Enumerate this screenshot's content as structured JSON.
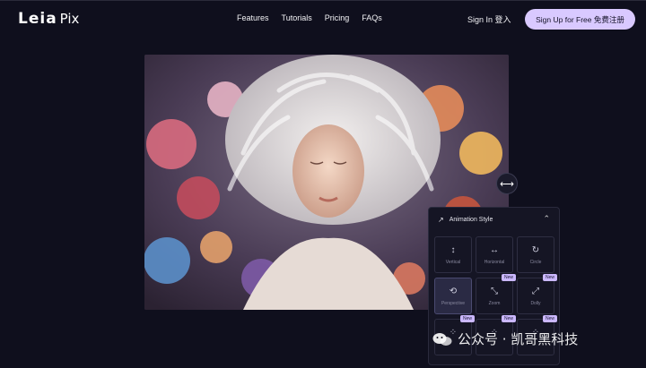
{
  "brand": {
    "logo_main": "Leia",
    "logo_sub": "Pix"
  },
  "nav": {
    "items": [
      "Features",
      "Tutorials",
      "Pricing",
      "FAQs"
    ]
  },
  "auth": {
    "signin_label": "Sign In 登入",
    "signup_label": "Sign Up for Free 免费注册"
  },
  "viewer": {
    "image_subject": "portrait of woman with white sculpted hair and colorful flowers",
    "compare_icon": "horizontal-arrows-icon"
  },
  "animation_panel": {
    "title": "Animation Style",
    "collapse_icon": "chevron-up-icon",
    "styles": [
      {
        "label": "Vertical",
        "icon": "vertical-arrows-icon",
        "new": "",
        "selected": false
      },
      {
        "label": "Horizontal",
        "icon": "horizontal-arrows-icon",
        "new": "",
        "selected": false
      },
      {
        "label": "Circle",
        "icon": "circle-arrow-icon",
        "new": "",
        "selected": false
      },
      {
        "label": "Perspective",
        "icon": "perspective-icon",
        "new": "",
        "selected": true
      },
      {
        "label": "Zoom",
        "icon": "zoom-icon",
        "new": "New",
        "selected": false
      },
      {
        "label": "Dolly",
        "icon": "dolly-icon",
        "new": "New",
        "selected": false
      },
      {
        "label": "",
        "icon": "effect-icon",
        "new": "New",
        "selected": false
      },
      {
        "label": "",
        "icon": "effect-icon",
        "new": "New",
        "selected": false
      },
      {
        "label": "",
        "icon": "effect-icon",
        "new": "New",
        "selected": false
      }
    ]
  },
  "watermark": {
    "text": "公众号 · 凯哥黑科技"
  },
  "colors": {
    "background": "#0f0f1d",
    "signup_bg": "#d9c9ff",
    "badge_bg": "#cbb8ff",
    "panel_bg": "#151524"
  }
}
